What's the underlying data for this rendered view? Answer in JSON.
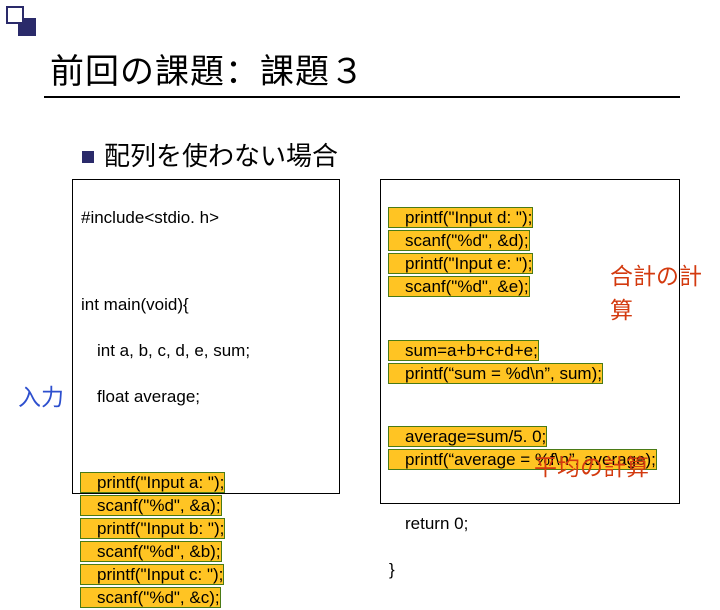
{
  "slide": {
    "title": "前回の課題：課題３",
    "bullet": "配列を使わない場合"
  },
  "code_left": {
    "l1": "#include<stdio. h>",
    "l2": "int main(void){",
    "l3": "int a, b, c, d, e, sum;",
    "l4": "float average;",
    "l5": "printf(\"Input a: \");",
    "l6": "scanf(\"%d\", &a);",
    "l7": "printf(\"Input b: \");",
    "l8": "scanf(\"%d\", &b);",
    "l9": "printf(\"Input c: \");",
    "l10": "scanf(\"%d\", &c);"
  },
  "code_right": {
    "l1": "printf(\"Input d: \");",
    "l2": "scanf(\"%d\", &d);",
    "l3": "printf(\"Input e: \");",
    "l4": "scanf(\"%d\", &e);",
    "l5": "sum=a+b+c+d+e;",
    "l6": "printf(“sum = %d\\n”, sum);",
    "l7": "average=sum/5. 0;",
    "l8": "printf(“average = %f\\n”, average);",
    "l9": "return 0;",
    "l10": "}"
  },
  "annotations": {
    "sum": "合計の計算",
    "avg": "平均の計算",
    "input": "入力"
  }
}
